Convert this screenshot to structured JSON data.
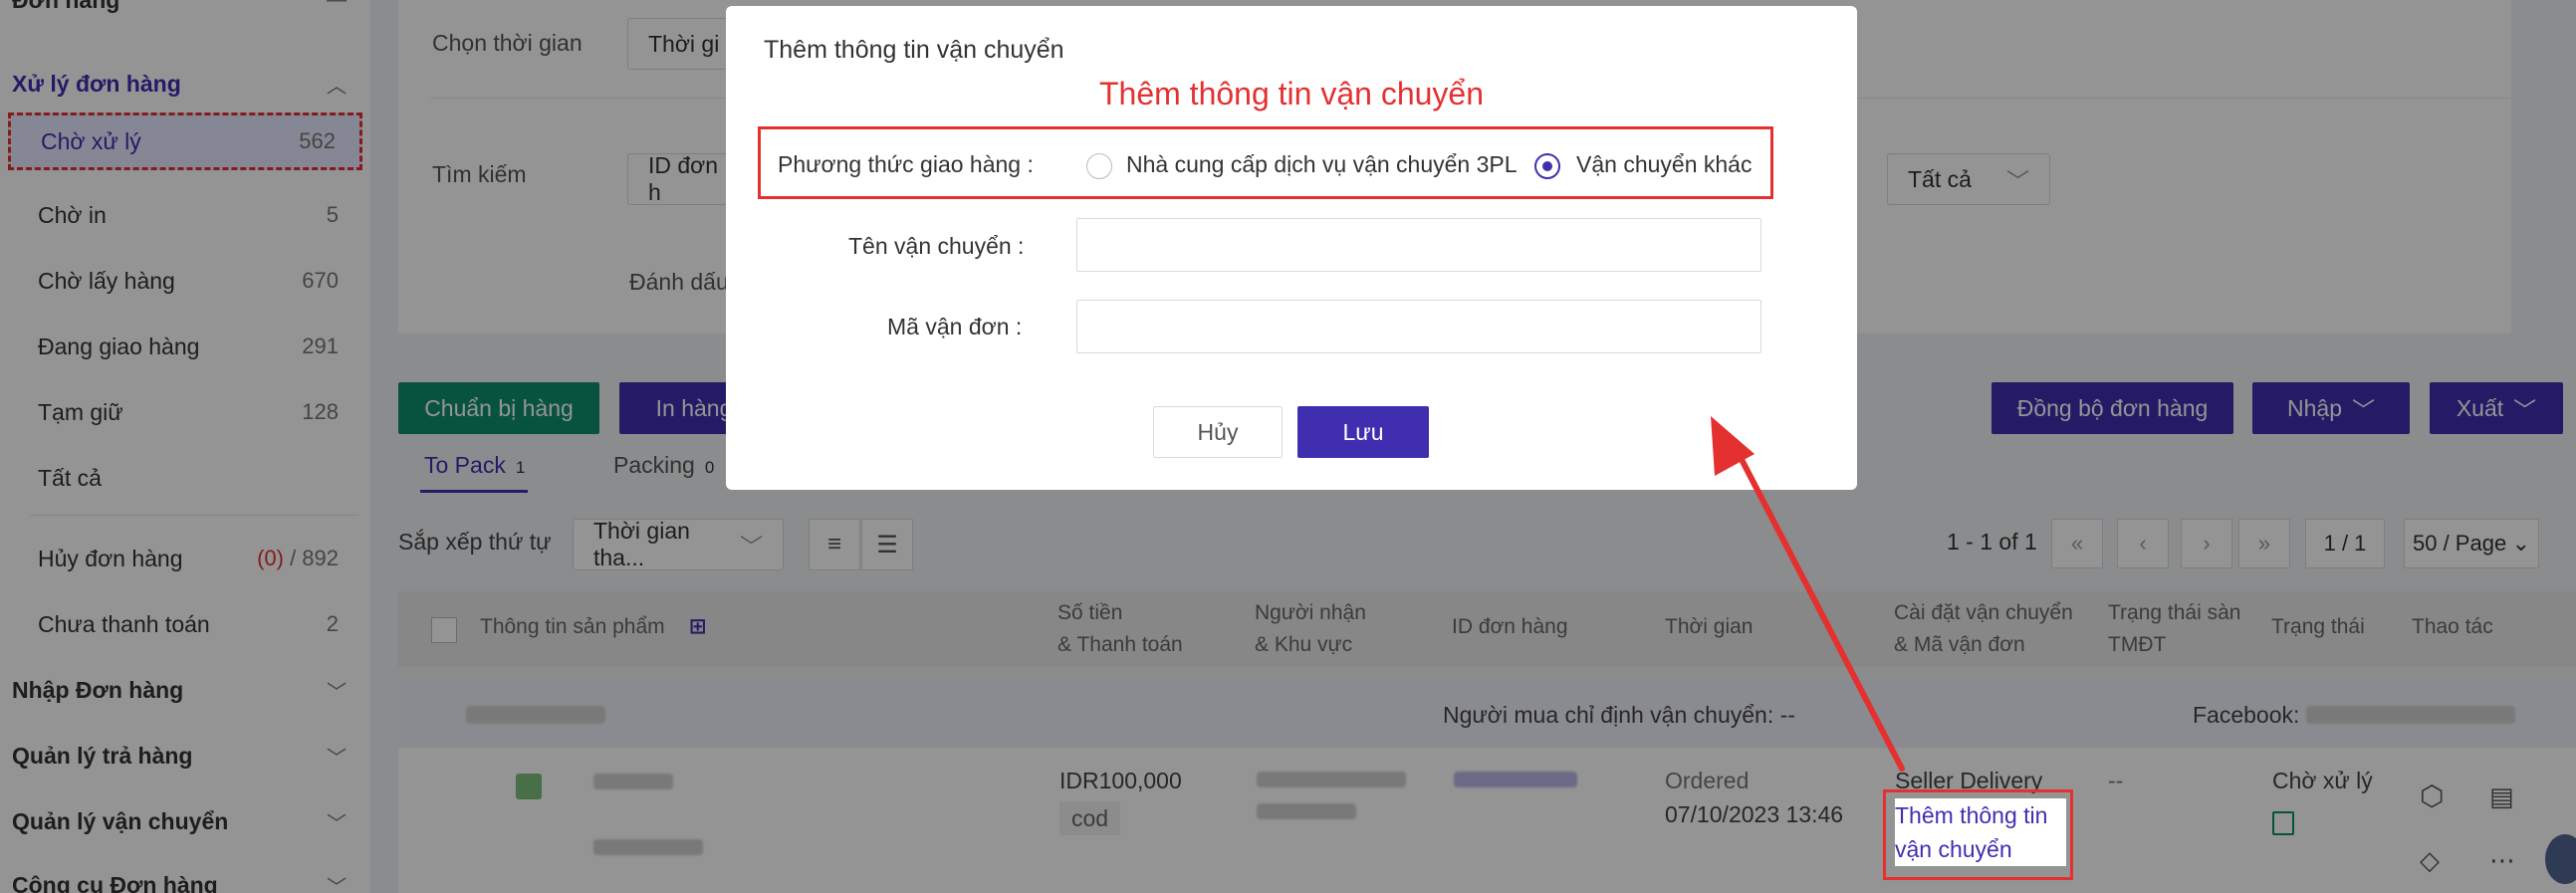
{
  "sidebar": {
    "top_cut_label": "Đơn hàng",
    "groups": [
      {
        "label": "Xử lý đơn hàng",
        "chevron": "chevron-up-icon"
      },
      {
        "label": "Nhập Đơn hàng",
        "chevron": "chevron-down-icon"
      },
      {
        "label": "Quản lý trả hàng",
        "chevron": "chevron-down-icon"
      },
      {
        "label": "Quản lý vận chuyển",
        "chevron": "chevron-down-icon"
      },
      {
        "label": "Công cụ Đơn hàng",
        "chevron": "chevron-down-icon"
      }
    ],
    "items": [
      {
        "label": "Chờ xử lý",
        "count": "562"
      },
      {
        "label": "Chờ in",
        "count": "5"
      },
      {
        "label": "Chờ lấy hàng",
        "count": "670"
      },
      {
        "label": "Đang giao hàng",
        "count": "291"
      },
      {
        "label": "Tạm giữ",
        "count": "128"
      },
      {
        "label": "Tất cả",
        "count": ""
      }
    ],
    "cancel_item": {
      "label": "Hủy đơn hàng",
      "count_red": "(0)",
      "count_rest": " / 892"
    },
    "unpaid_item": {
      "label": "Chưa thanh toán",
      "count": "2"
    }
  },
  "filters": {
    "time_label": "Chọn thời gian",
    "time_value": "Thời gi",
    "search_label": "Tìm kiếm",
    "search_value": "ID đơn h",
    "mark_label": "Đánh dấu",
    "all_select": "Tất cả"
  },
  "toolbar": {
    "prepare": "Chuẩn bị hàng",
    "print": "In hàng",
    "sync": "Đồng bộ đơn hàng",
    "import": "Nhập",
    "export": "Xuất"
  },
  "tabs": [
    {
      "label": "To Pack",
      "num": "1"
    },
    {
      "label": "Packing",
      "num": "0"
    }
  ],
  "sort": {
    "label": "Sắp xếp thứ tự",
    "value": "Thời gian tha..."
  },
  "pagination": {
    "range": "1 - 1 of 1",
    "page": "1 / 1",
    "per_page": "50 / Page"
  },
  "table": {
    "headers": {
      "product": "Thông tin sản phẩm",
      "amount_1": "Số tiền",
      "amount_2": "& Thanh toán",
      "recipient_1": "Người nhận",
      "recipient_2": "& Khu vực",
      "order_id": "ID đơn hàng",
      "time": "Thời gian",
      "shipping_1": "Cài đặt vận chuyển",
      "shipping_2": "& Mã vận đơn",
      "platform_1": "Trạng thái sàn",
      "platform_2": "TMĐT",
      "status": "Trạng thái",
      "actions": "Thao tác"
    },
    "group_row": {
      "buyer_shipping": "Người mua chỉ định vận chuyển: --",
      "facebook": "Facebook:"
    },
    "row": {
      "amount": "IDR100,000",
      "payment": "cod",
      "status_text": "Ordered",
      "time": "07/10/2023 13:46",
      "shipping_name": "Seller Delivery",
      "shipping_link": "Thêm thông tin vận chuyển",
      "platform_status": "--",
      "status": "Chờ xử lý"
    }
  },
  "modal": {
    "title": "Thêm thông tin vận chuyển",
    "annotation": "Thêm thông tin vận chuyển",
    "method_label": "Phương thức giao hàng :",
    "option_3pl": "Nhà cung cấp dịch vụ vận chuyển 3PL",
    "option_other": "Vận chuyển khác",
    "carrier_label": "Tên vận chuyển :",
    "carrier_value": "",
    "tracking_label": "Mã vận đơn :",
    "tracking_value": "",
    "cancel": "Hủy",
    "save": "Lưu"
  },
  "colors": {
    "accent": "#3f2fb0",
    "green": "#0e8f6e",
    "annotation_red": "#e53030"
  }
}
